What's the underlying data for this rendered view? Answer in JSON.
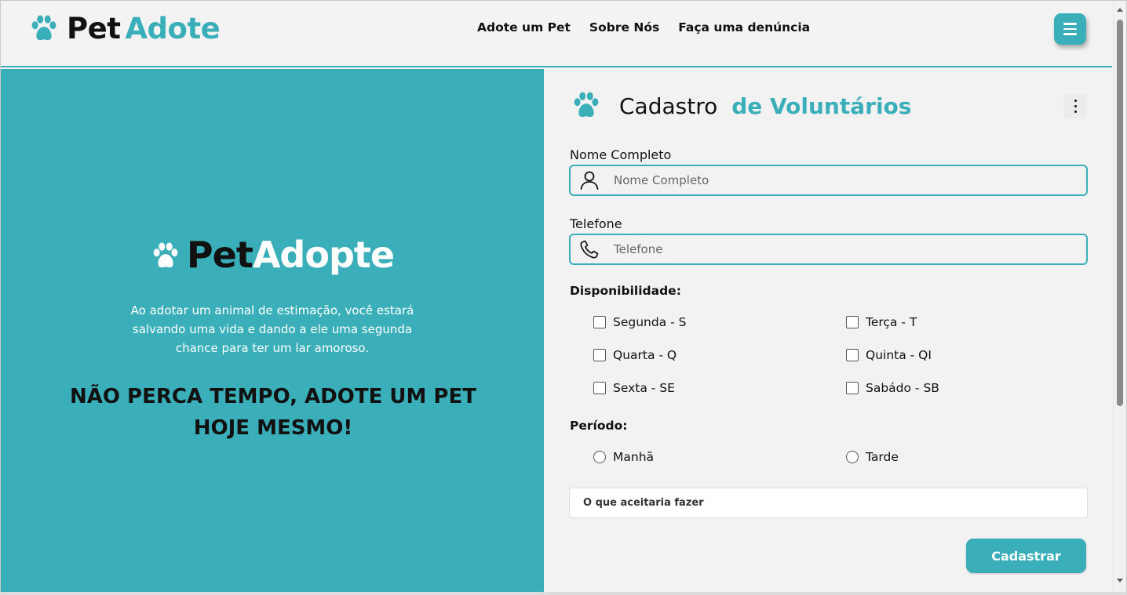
{
  "navbar": {
    "brand_part1": "Pet",
    "brand_part2": "Adote",
    "links": [
      "Adote um Pet",
      "Sobre Nós",
      "Faça uma denúncia"
    ]
  },
  "hero": {
    "logo_part1": "Pet",
    "logo_part2": "Adopte",
    "text": "Ao adotar um animal de estimação, você estará salvando uma vida e dando a ele uma segunda chance para ter um lar amoroso.",
    "cta": "NÃO PERCA TEMPO, ADOTE UM PET HOJE MESMO!"
  },
  "form": {
    "title_part1": "Cadastro",
    "title_part2": "de Voluntários",
    "name_label": "Nome Completo",
    "name_placeholder": "Nome Completo",
    "phone_label": "Telefone",
    "phone_placeholder": "Telefone",
    "availability_label": "Disponibilidade:",
    "days": [
      "Segunda - S",
      "Terça - T",
      "Quarta - Q",
      "Quinta - QI",
      "Sexta - SE",
      "Sabádo - SB"
    ],
    "period_label": "Período:",
    "periods": [
      "Manhã",
      "Tarde"
    ],
    "tasks_placeholder": "O que aceitaria fazer",
    "submit_label": "Cadastrar"
  },
  "colors": {
    "accent": "#3aafb9",
    "background": "#f2f2f2"
  },
  "icons": {
    "brand": "paw-icon",
    "menu": "hamburger-menu-icon",
    "options": "kebab-menu-icon",
    "name_field": "user-icon",
    "phone_field": "phone-icon"
  }
}
